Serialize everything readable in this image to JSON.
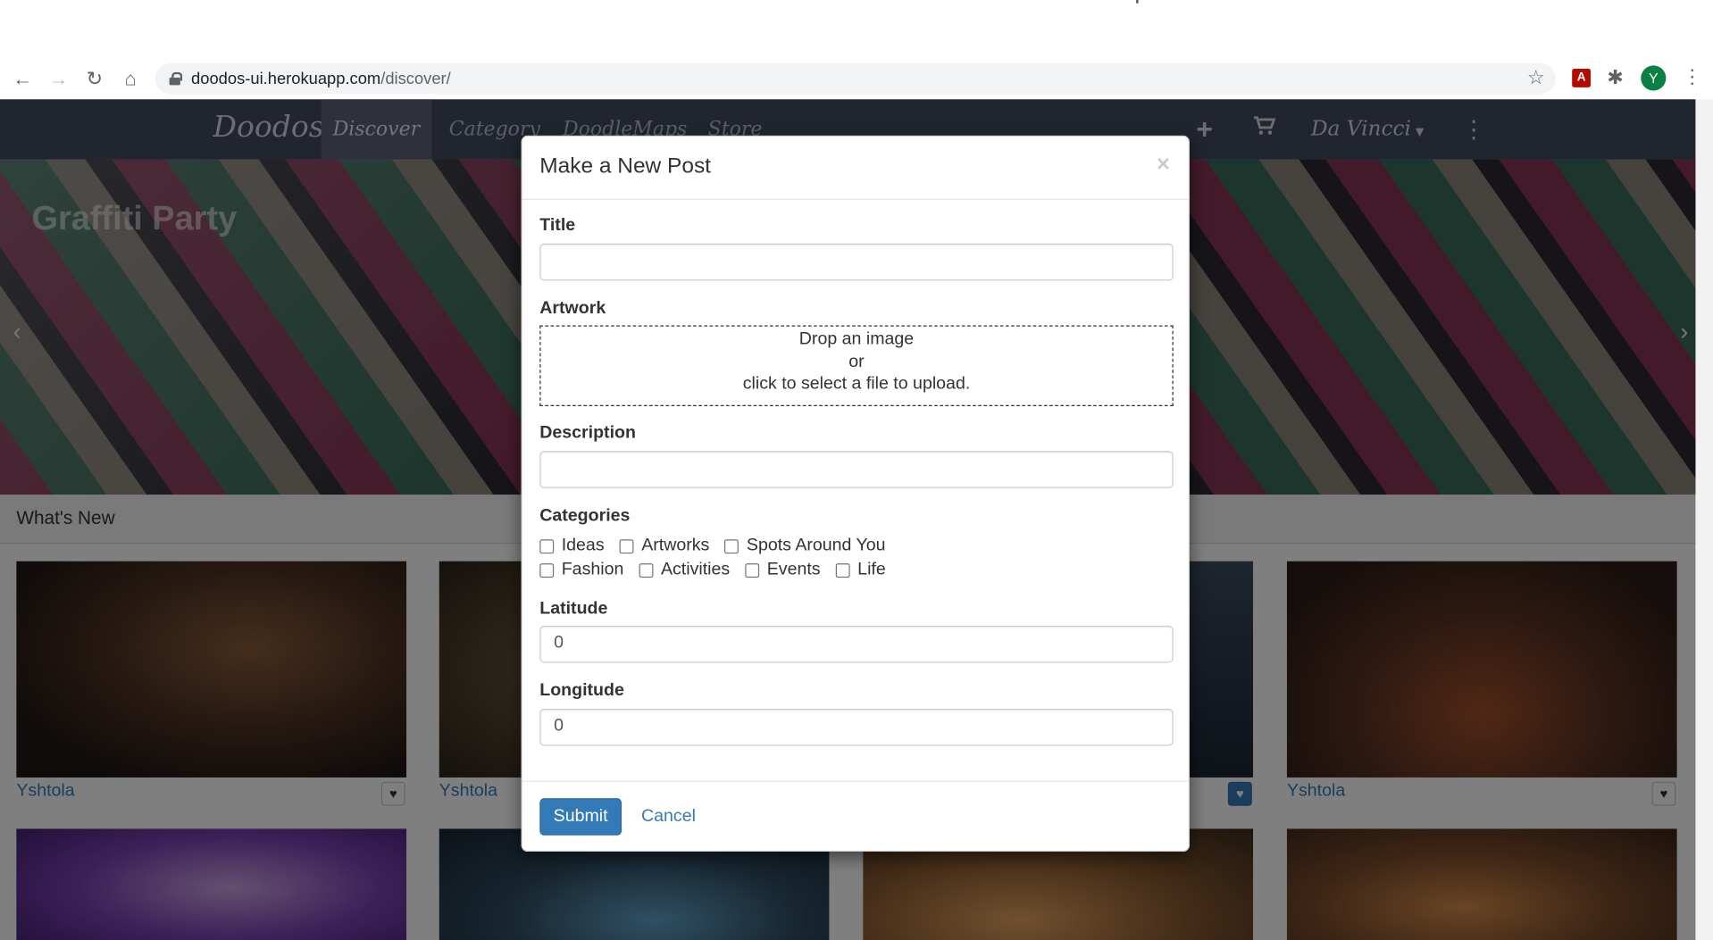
{
  "browser": {
    "url_host": "doodos-ui.herokuapp.com",
    "url_path": "/discover/",
    "avatar_letter": "Y",
    "pdf_ext_letter": "A",
    "icons": [
      "back-icon",
      "forward-icon",
      "reload-icon",
      "home-icon",
      "lock-icon",
      "bookmark-star-icon",
      "pdf-extension-icon",
      "extensions-puzzle-icon",
      "chrome-menu-icon"
    ]
  },
  "nav": {
    "brand": "Doodos",
    "links": [
      "Discover",
      "Category",
      "DoodleMaps",
      "Store"
    ],
    "active": "Discover",
    "user": "Da Vincci"
  },
  "hero": {
    "title": "Graffiti Party"
  },
  "feed": {
    "heading": "What's New",
    "tiles": [
      {
        "author": "Yshtola",
        "liked": false
      },
      {
        "author": "Yshtola",
        "liked": false
      },
      {
        "author": "",
        "liked": true
      },
      {
        "author": "Yshtola",
        "liked": false
      }
    ]
  },
  "modal": {
    "title": "Make a New Post",
    "close": "×",
    "title_label": "Title",
    "title_value": "",
    "artwork_label": "Artwork",
    "dropzone_line1": "Drop an image",
    "dropzone_line2": "or",
    "dropzone_line3": "click to select a file to upload.",
    "description_label": "Description",
    "description_value": "",
    "categories_label": "Categories",
    "categories_row1": [
      "Ideas",
      "Artworks",
      "Spots Around You"
    ],
    "categories_row2": [
      "Fashion",
      "Activities",
      "Events",
      "Life"
    ],
    "latitude_label": "Latitude",
    "latitude_value": "0",
    "longitude_label": "Longitude",
    "longitude_value": "0",
    "submit": "Submit",
    "cancel": "Cancel"
  },
  "colors": {
    "navbar": "#434a5f",
    "primary": "#337ab7"
  }
}
